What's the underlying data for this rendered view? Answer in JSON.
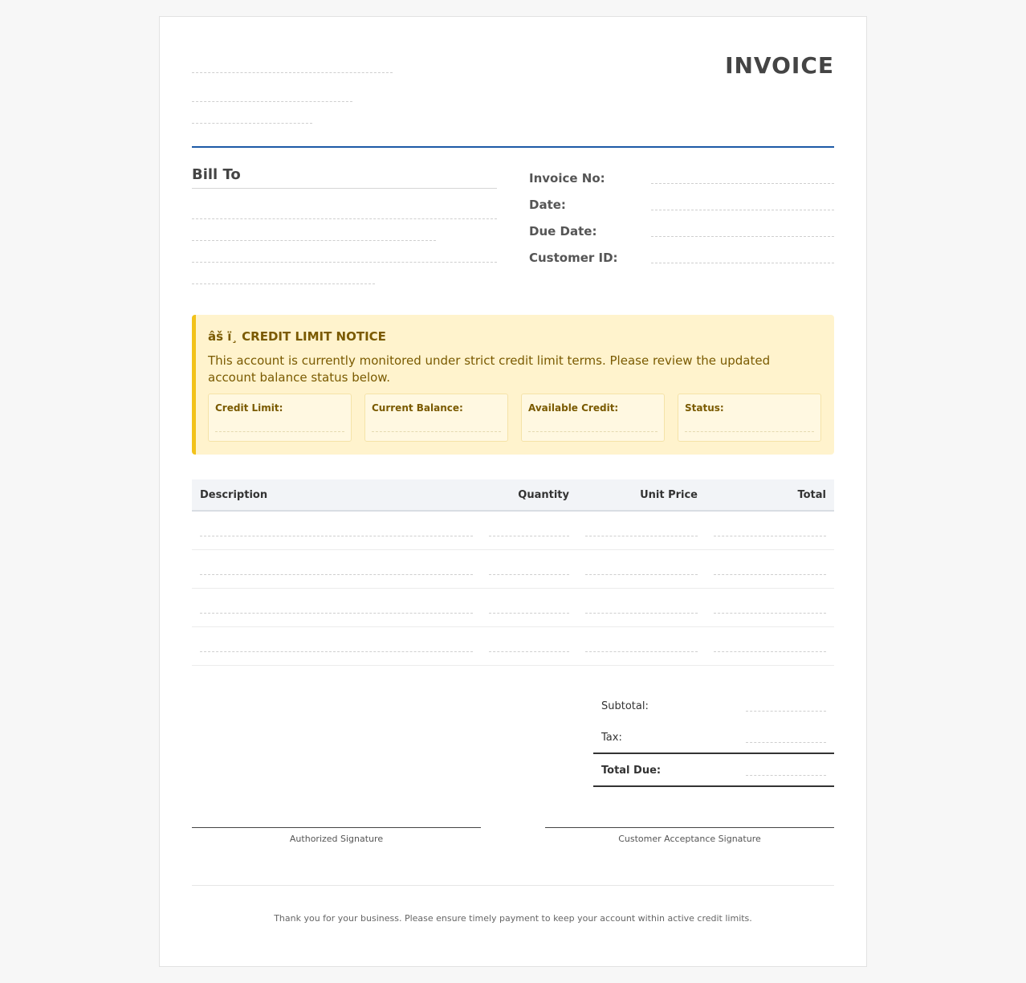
{
  "header": {
    "title": "INVOICE"
  },
  "bill_to": {
    "title": "Bill To"
  },
  "meta": {
    "invoice_no_label": "Invoice No:",
    "date_label": "Date:",
    "due_date_label": "Due Date:",
    "customer_id_label": "Customer ID:"
  },
  "notice": {
    "icon_text": "âš ï¸",
    "title": "CREDIT LIMIT NOTICE",
    "text": "This account is currently monitored under strict credit limit terms. Please review the updated account balance status below.",
    "fields": [
      "Credit Limit:",
      "Current Balance:",
      "Available Credit:",
      "Status:"
    ],
    "accent_color": "#f2c21b",
    "background_color": "#fff3cd"
  },
  "table": {
    "headers": [
      "Description",
      "Quantity",
      "Unit Price",
      "Total"
    ]
  },
  "totals": {
    "subtotal_label": "Subtotal:",
    "tax_label": "Tax:",
    "total_due_label": "Total Due:"
  },
  "signatures": {
    "authorized": "Authorized Signature",
    "customer": "Customer Acceptance Signature"
  },
  "footer": {
    "text": "Thank you for your business. Please ensure timely payment to keep your account within active credit limits."
  },
  "colors": {
    "accent_rule": "#1d5aa6"
  }
}
